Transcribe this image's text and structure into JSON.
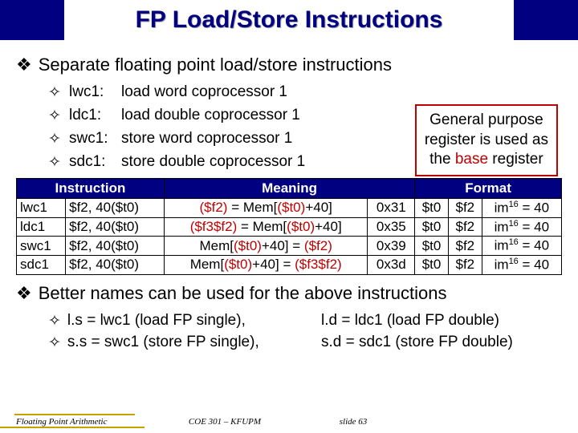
{
  "title": "FP Load/Store Instructions",
  "heading1": "Separate floating point load/store instructions",
  "subitems": [
    {
      "mnem": "lwc1:",
      "desc": "load word coprocessor 1"
    },
    {
      "mnem": "ldc1:",
      "desc": "load double coprocessor 1"
    },
    {
      "mnem": "swc1:",
      "desc": "store word coprocessor 1"
    },
    {
      "mnem": "sdc1:",
      "desc": "store double coprocessor 1"
    }
  ],
  "callout": {
    "line1": "General purpose",
    "line2": "register is used as",
    "line3_a": "the ",
    "line3_b": "base",
    "line3_c": " register"
  },
  "table": {
    "headers": {
      "c1": "Instruction",
      "c2": "Meaning",
      "c3": "Format"
    },
    "rows": [
      {
        "op": "lwc1",
        "args": "$f2, 40($t0)",
        "m1": "($f2)",
        "m2": " = Mem[",
        "m3": "($t0)",
        "m4": "+40]",
        "hex": "0x31",
        "r1": "$t0",
        "r2": "$f2",
        "imm": "im",
        "sup": "16",
        "eq": " = 40"
      },
      {
        "op": "ldc1",
        "args": "$f2, 40($t0)",
        "m1": "($f3$f2)",
        "m2": " = Mem[",
        "m3": "($t0)",
        "m4": "+40]",
        "hex": "0x35",
        "r1": "$t0",
        "r2": "$f2",
        "imm": "im",
        "sup": "16",
        "eq": " = 40"
      },
      {
        "op": "swc1",
        "args": "$f2, 40($t0)",
        "m1pre": "Mem[",
        "m1": "($t0)",
        "m2": "+40] = ",
        "m3": "($f2)",
        "hex": "0x39",
        "r1": "$t0",
        "r2": "$f2",
        "imm": "im",
        "sup": "16",
        "eq": " = 40"
      },
      {
        "op": "sdc1",
        "args": "$f2, 40($t0)",
        "m1pre": "Mem[",
        "m1": "($t0)",
        "m2": "+40] = ",
        "m3": "($f3$f2)",
        "hex": "0x3d",
        "r1": "$t0",
        "r2": "$f2",
        "imm": "im",
        "sup": "16",
        "eq": " = 40"
      }
    ]
  },
  "heading2": "Better names can be used for the above instructions",
  "pairs": [
    {
      "left": "l.s = lwc1 (load FP single),",
      "right": "l.d = ldc1 (load FP double)"
    },
    {
      "left": "s.s = swc1 (store FP single),",
      "right": "s.d = sdc1 (store FP double)"
    }
  ],
  "footer": {
    "f1": "Floating Point Arithmetic",
    "f2": "COE 301 – KFUPM",
    "f3": "slide 63"
  }
}
